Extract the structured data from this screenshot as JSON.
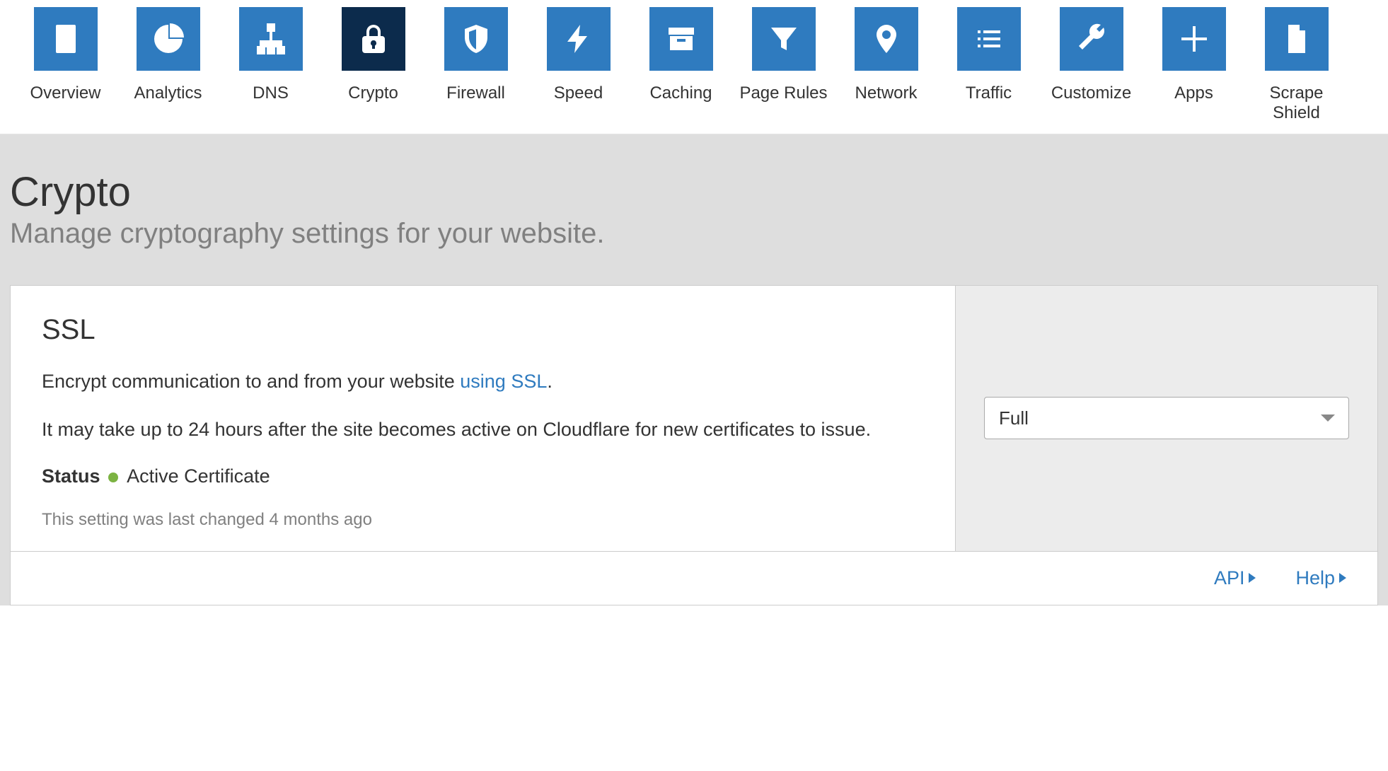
{
  "nav": {
    "items": [
      {
        "key": "overview",
        "label": "Overview",
        "icon": "clipboard"
      },
      {
        "key": "analytics",
        "label": "Analytics",
        "icon": "pie"
      },
      {
        "key": "dns",
        "label": "DNS",
        "icon": "sitemap"
      },
      {
        "key": "crypto",
        "label": "Crypto",
        "icon": "lock",
        "active": true
      },
      {
        "key": "firewall",
        "label": "Firewall",
        "icon": "shield"
      },
      {
        "key": "speed",
        "label": "Speed",
        "icon": "bolt"
      },
      {
        "key": "caching",
        "label": "Caching",
        "icon": "archive"
      },
      {
        "key": "page-rules",
        "label": "Page Rules",
        "icon": "funnel"
      },
      {
        "key": "network",
        "label": "Network",
        "icon": "marker"
      },
      {
        "key": "traffic",
        "label": "Traffic",
        "icon": "list"
      },
      {
        "key": "customize",
        "label": "Customize",
        "icon": "wrench"
      },
      {
        "key": "apps",
        "label": "Apps",
        "icon": "plus"
      },
      {
        "key": "scrape-shield",
        "label": "Scrape Shield",
        "icon": "file"
      }
    ]
  },
  "header": {
    "title": "Crypto",
    "subtitle": "Manage cryptography settings for your website."
  },
  "ssl_card": {
    "title": "SSL",
    "desc_prefix": "Encrypt communication to and from your website ",
    "desc_link": "using SSL",
    "desc_suffix": ".",
    "note": "It may take up to 24 hours after the site becomes active on Cloudflare for new certificates to issue.",
    "status_label": "Status",
    "status_value": "Active Certificate",
    "status_color": "#7cb342",
    "last_changed": "This setting was last changed 4 months ago",
    "select_value": "Full",
    "footer": {
      "api": "API",
      "help": "Help"
    }
  }
}
